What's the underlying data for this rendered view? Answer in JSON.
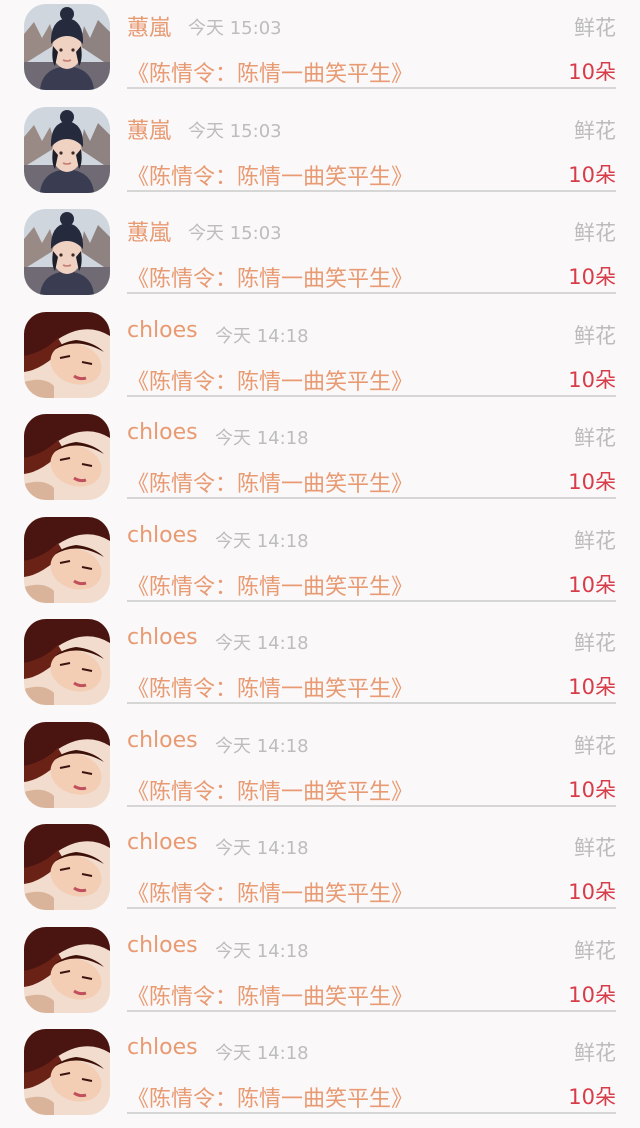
{
  "records": [
    {
      "name": "蕙嵐",
      "time": "今天 15:03",
      "gift": "鲜花",
      "work": "《陈情令：陈情一曲笑平生》",
      "count": "10朵",
      "avatar": "avatar-hat-woman"
    },
    {
      "name": "蕙嵐",
      "time": "今天 15:03",
      "gift": "鲜花",
      "work": "《陈情令：陈情一曲笑平生》",
      "count": "10朵",
      "avatar": "avatar-hat-woman"
    },
    {
      "name": "蕙嵐",
      "time": "今天 15:03",
      "gift": "鲜花",
      "work": "《陈情令：陈情一曲笑平生》",
      "count": "10朵",
      "avatar": "avatar-hat-woman"
    },
    {
      "name": "chloes",
      "time": "今天 14:18",
      "gift": "鲜花",
      "work": "《陈情令：陈情一曲笑平生》",
      "count": "10朵",
      "avatar": "avatar-reclining-woman"
    },
    {
      "name": "chloes",
      "time": "今天 14:18",
      "gift": "鲜花",
      "work": "《陈情令：陈情一曲笑平生》",
      "count": "10朵",
      "avatar": "avatar-reclining-woman"
    },
    {
      "name": "chloes",
      "time": "今天 14:18",
      "gift": "鲜花",
      "work": "《陈情令：陈情一曲笑平生》",
      "count": "10朵",
      "avatar": "avatar-reclining-woman"
    },
    {
      "name": "chloes",
      "time": "今天 14:18",
      "gift": "鲜花",
      "work": "《陈情令：陈情一曲笑平生》",
      "count": "10朵",
      "avatar": "avatar-reclining-woman"
    },
    {
      "name": "chloes",
      "time": "今天 14:18",
      "gift": "鲜花",
      "work": "《陈情令：陈情一曲笑平生》",
      "count": "10朵",
      "avatar": "avatar-reclining-woman"
    },
    {
      "name": "chloes",
      "time": "今天 14:18",
      "gift": "鲜花",
      "work": "《陈情令：陈情一曲笑平生》",
      "count": "10朵",
      "avatar": "avatar-reclining-woman"
    },
    {
      "name": "chloes",
      "time": "今天 14:18",
      "gift": "鲜花",
      "work": "《陈情令：陈情一曲笑平生》",
      "count": "10朵",
      "avatar": "avatar-reclining-woman"
    },
    {
      "name": "chloes",
      "time": "今天 14:18",
      "gift": "鲜花",
      "work": "《陈情令：陈情一曲笑平生》",
      "count": "10朵",
      "avatar": "avatar-reclining-woman"
    }
  ],
  "colors": {
    "background": "#faf8f9",
    "accent": "#e89a72",
    "count": "#d73c48",
    "muted": "#bcbcbc",
    "divider": "#d6d6d6"
  }
}
